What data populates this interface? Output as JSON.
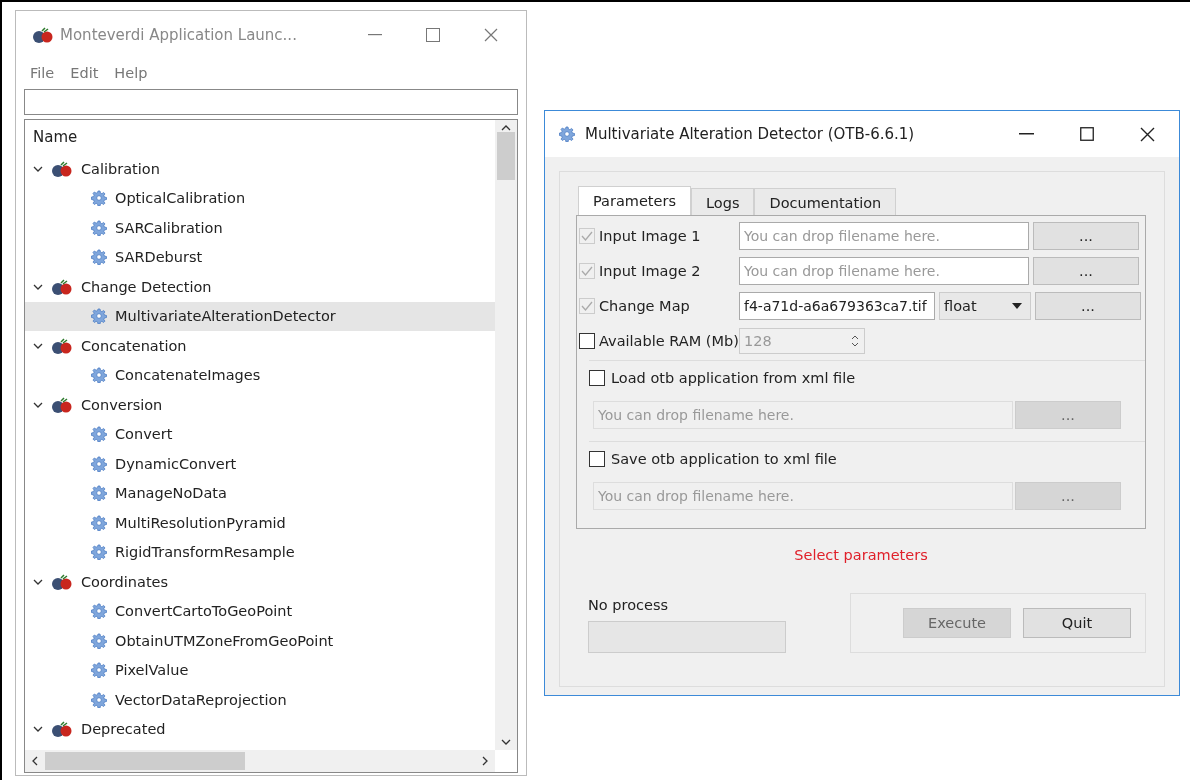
{
  "launcher": {
    "title": "Monteverdi Application Launc...",
    "menu": [
      "File",
      "Edit",
      "Help"
    ],
    "tree_header": "Name",
    "tree": [
      {
        "label": "Calibration",
        "expanded": true,
        "children": [
          {
            "label": "OpticalCalibration",
            "selected": false
          },
          {
            "label": "SARCalibration",
            "selected": false
          },
          {
            "label": "SARDeburst",
            "selected": false
          }
        ]
      },
      {
        "label": "Change Detection",
        "expanded": true,
        "children": [
          {
            "label": "MultivariateAlterationDetector",
            "selected": true
          }
        ]
      },
      {
        "label": "Concatenation",
        "expanded": true,
        "children": [
          {
            "label": "ConcatenateImages",
            "selected": false
          }
        ]
      },
      {
        "label": "Conversion",
        "expanded": true,
        "children": [
          {
            "label": "Convert",
            "selected": false
          },
          {
            "label": "DynamicConvert",
            "selected": false
          },
          {
            "label": "ManageNoData",
            "selected": false
          },
          {
            "label": "MultiResolutionPyramid",
            "selected": false
          },
          {
            "label": "RigidTransformResample",
            "selected": false
          }
        ]
      },
      {
        "label": "Coordinates",
        "expanded": true,
        "children": [
          {
            "label": "ConvertCartoToGeoPoint",
            "selected": false
          },
          {
            "label": "ObtainUTMZoneFromGeoPoint",
            "selected": false
          },
          {
            "label": "PixelValue",
            "selected": false
          },
          {
            "label": "VectorDataReprojection",
            "selected": false
          }
        ]
      },
      {
        "label": "Deprecated",
        "expanded": true
      }
    ]
  },
  "dialog": {
    "title": "Multivariate Alteration Detector (OTB-6.6.1)",
    "tabs": [
      {
        "label": "Parameters",
        "selected": true
      },
      {
        "label": "Logs",
        "selected": false
      },
      {
        "label": "Documentation",
        "selected": false
      }
    ],
    "params": [
      {
        "kind": "file",
        "label": "Input Image 1",
        "checked": true,
        "disabled": true,
        "placeholder": "You can drop filename here.",
        "button": "..."
      },
      {
        "kind": "file",
        "label": "Input Image 2",
        "checked": true,
        "disabled": true,
        "placeholder": "You can drop filename here.",
        "button": "..."
      },
      {
        "kind": "output",
        "label": "Change Map",
        "checked": true,
        "disabled": true,
        "value": "f4-a71d-a6a679363ca7.tif",
        "type": "float",
        "button": "..."
      },
      {
        "kind": "spin",
        "label": "Available RAM (Mb)",
        "checked": false,
        "disabled": false,
        "value": "128"
      }
    ],
    "groups": [
      {
        "label": "Load otb application from xml file",
        "checked": false,
        "placeholder": "You can drop filename here.",
        "button": "..."
      },
      {
        "label": "Save otb application to xml file",
        "checked": false,
        "placeholder": "You can drop filename here.",
        "button": "..."
      }
    ],
    "status": "Select parameters",
    "progress_label": "No process",
    "progress": {
      "level": 0
    },
    "buttons": [
      {
        "label": "Execute",
        "disabled": true
      },
      {
        "label": "Quit",
        "disabled": false
      }
    ]
  }
}
